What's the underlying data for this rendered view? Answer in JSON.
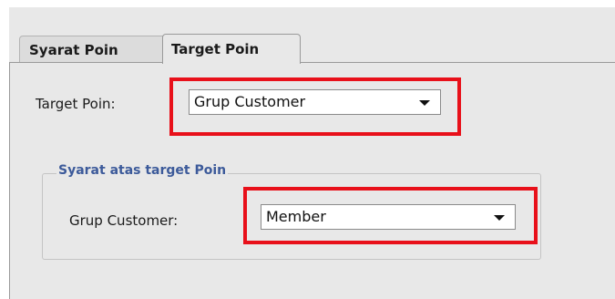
{
  "tabs": [
    {
      "label": "Syarat Poin",
      "active": false
    },
    {
      "label": "Target Poin",
      "active": true
    }
  ],
  "target_poin": {
    "label": "Target Poin:",
    "selected": "Grup Customer"
  },
  "syarat_group": {
    "legend": "Syarat atas target Poin",
    "grup_customer_label": "Grup Customer:",
    "grup_customer_selected": "Member"
  },
  "colors": {
    "highlight": "#e8101a",
    "legend_text": "#3c5a9a",
    "panel_bg": "#e8e8e8"
  }
}
